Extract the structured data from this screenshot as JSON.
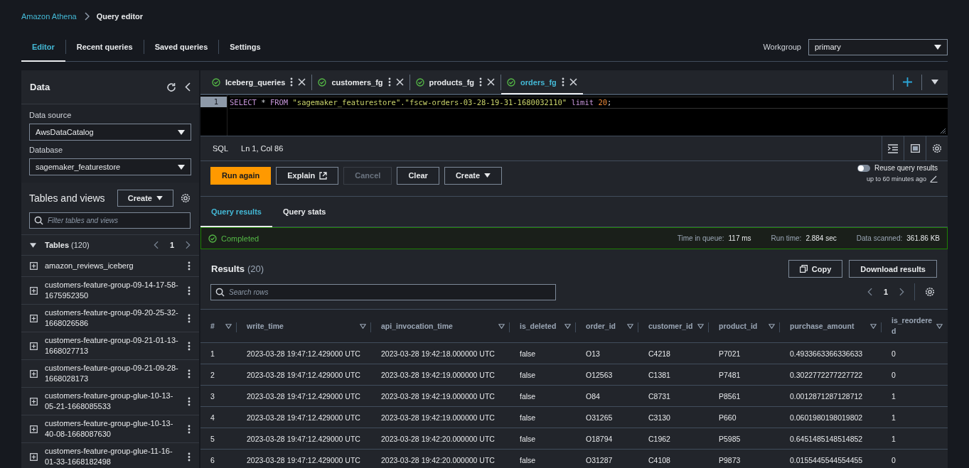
{
  "breadcrumb": [
    {
      "label": "Amazon Athena",
      "kind": "link"
    },
    {
      "label": "Query editor",
      "kind": "current"
    }
  ],
  "tabs": [
    {
      "label": "Editor",
      "selected": true
    },
    {
      "label": "Recent queries",
      "selected": false
    },
    {
      "label": "Saved queries",
      "selected": false
    },
    {
      "label": "Settings",
      "selected": false
    }
  ],
  "workgroup": {
    "label": "Workgroup",
    "value": "primary"
  },
  "sidebar": {
    "title": "Data",
    "data_source": {
      "label": "Data source",
      "value": "AwsDataCatalog"
    },
    "database": {
      "label": "Database",
      "value": "sagemaker_featurestore"
    },
    "tables_title": "Tables and views",
    "create_button": "Create",
    "filter": {
      "placeholder": "Filter tables and views"
    },
    "group": {
      "label": "Tables",
      "count": "(120)",
      "expanded": true,
      "page": "1",
      "items": [
        {
          "label": "amazon_reviews_iceberg"
        },
        {
          "label": "customers-feature-group-09-14-17-58-1675952350"
        },
        {
          "label": "customers-feature-group-09-20-25-32-1668026586"
        },
        {
          "label": "customers-feature-group-09-21-01-13-1668027713"
        },
        {
          "label": "customers-feature-group-09-21-09-28-1668028173"
        },
        {
          "label": "customers-feature-group-glue-10-13-05-21-1668085533"
        },
        {
          "label": "customers-feature-group-glue-10-13-40-08-1668087630"
        },
        {
          "label": "customers-feature-group-glue-11-16-01-33-1668182498"
        }
      ]
    }
  },
  "query_tabs": [
    {
      "label": "Iceberg_queries",
      "selected": false
    },
    {
      "label": "customers_fg",
      "selected": false
    },
    {
      "label": "products_fg",
      "selected": false
    },
    {
      "label": "orders_fg",
      "selected": true
    }
  ],
  "editor": {
    "line_number": "1",
    "tokens": [
      {
        "text": "SELECT",
        "kind": "keyword"
      },
      {
        "text": " * ",
        "kind": "plain"
      },
      {
        "text": "FROM",
        "kind": "keyword"
      },
      {
        "text": " \"sagemaker_featurestore\".\"fscw-orders-03-28-19-31-1680032110\" ",
        "kind": "string"
      },
      {
        "text": "limit",
        "kind": "keyword"
      },
      {
        "text": " 20",
        "kind": "number"
      },
      {
        "text": ";",
        "kind": "plain"
      }
    ]
  },
  "status": {
    "language": "SQL",
    "position": "Ln 1, Col 86"
  },
  "actions": [
    {
      "label": "Run again",
      "kind": "primary",
      "disabled": false
    },
    {
      "label": "Explain",
      "kind": "external",
      "disabled": false
    },
    {
      "label": "Cancel",
      "kind": "normal",
      "disabled": true
    },
    {
      "label": "Clear",
      "kind": "normal",
      "disabled": false
    },
    {
      "label": "Create",
      "kind": "dropdown",
      "disabled": false
    }
  ],
  "reuse": {
    "label": "Reuse query results",
    "on": false,
    "note": "up to 60 minutes ago"
  },
  "result_tabs": [
    {
      "label": "Query results",
      "selected": true
    },
    {
      "label": "Query stats",
      "selected": false
    }
  ],
  "status_bar": {
    "status": "Completed",
    "stats": [
      {
        "label": "Time in queue:",
        "value": "117 ms"
      },
      {
        "label": "Run time:",
        "value": "2.884 sec"
      },
      {
        "label": "Data scanned:",
        "value": "361.86 KB"
      }
    ]
  },
  "results": {
    "title": "Results",
    "count": "(20)",
    "buttons": [
      {
        "label": "Copy",
        "kind": "copy"
      },
      {
        "label": "Download results",
        "kind": "plain"
      }
    ],
    "search": {
      "placeholder": "Search rows"
    },
    "page": "1",
    "columns": [
      "#",
      "write_time",
      "api_invocation_time",
      "is_deleted",
      "order_id",
      "customer_id",
      "product_id",
      "purchase_amount",
      "is_reordered"
    ],
    "rows": [
      [
        "1",
        "2023-03-28 19:47:12.429000 UTC",
        "2023-03-28 19:42:18.000000 UTC",
        "false",
        "O13",
        "C4218",
        "P7021",
        "0.4933663366336633",
        "0"
      ],
      [
        "2",
        "2023-03-28 19:47:12.429000 UTC",
        "2023-03-28 19:42:19.000000 UTC",
        "false",
        "O12563",
        "C1381",
        "P7481",
        "0.3022772277227722",
        "0"
      ],
      [
        "3",
        "2023-03-28 19:47:12.429000 UTC",
        "2023-03-28 19:42:19.000000 UTC",
        "false",
        "O84",
        "C8731",
        "P8561",
        "0.0012871287128712",
        "1"
      ],
      [
        "4",
        "2023-03-28 19:47:12.429000 UTC",
        "2023-03-28 19:42:19.000000 UTC",
        "false",
        "O31265",
        "C3130",
        "P660",
        "0.0601980198019802",
        "1"
      ],
      [
        "5",
        "2023-03-28 19:47:12.429000 UTC",
        "2023-03-28 19:42:20.000000 UTC",
        "false",
        "O18794",
        "C1962",
        "P5985",
        "0.6451485148514852",
        "1"
      ],
      [
        "6",
        "2023-03-28 19:47:12.429000 UTC",
        "2023-03-28 19:42:20.000000 UTC",
        "false",
        "O31287",
        "C4108",
        "P9873",
        "0.0155445544554455",
        "0"
      ]
    ]
  }
}
